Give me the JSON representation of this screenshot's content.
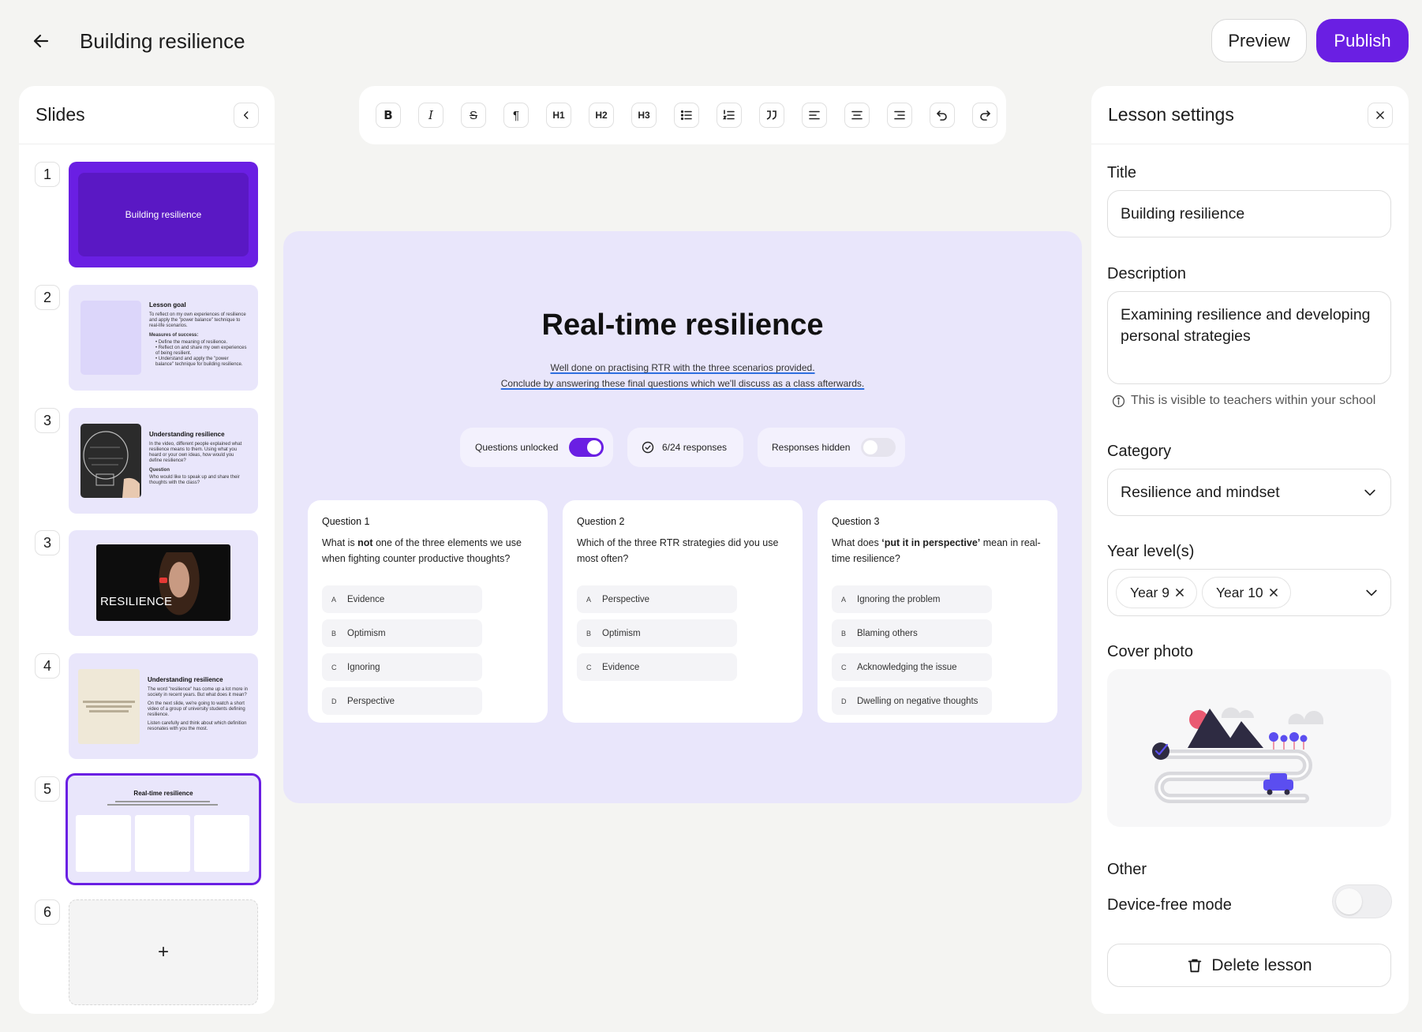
{
  "header": {
    "title": "Building resilience",
    "preview_label": "Preview",
    "publish_label": "Publish"
  },
  "colors": {
    "accent": "#6a1fe3",
    "canvas": "#e9e6fb",
    "background": "#f4f4f2"
  },
  "slides_panel": {
    "title": "Slides",
    "slides": [
      {
        "number": "1",
        "title": "Building resilience",
        "type": "title"
      },
      {
        "number": "2",
        "title": "Lesson goal",
        "body": "To reflect on my own experiences of resilience and apply the \"power balance\" technique to real-life scenarios.",
        "subhead": "Measures of success:",
        "bullets": [
          "Define the meaning of resilience.",
          "Reflect on and share my own experiences of being resilient.",
          "Understand and apply the \"power balance\" technique for building resilience."
        ]
      },
      {
        "number": "3",
        "title": "Understanding resilience",
        "body": "In the video, different people explained what resilience means to them. Using what you heard or your own ideas, how would you define resilience?",
        "subhead": "Question",
        "question": "Who would like to speak up and share their thoughts with the class?"
      },
      {
        "number": "3",
        "title": "RESILIENCE",
        "type": "video"
      },
      {
        "number": "4",
        "title": "Understanding resilience",
        "body1": "The word \"resilience\" has come up a lot more in society in recent years. But what does it mean?",
        "body2": "On the next slide, we're going to watch a short video of a group of university students defining resilience.",
        "body3": "Listen carefully and think about which definition resonates with you the most."
      },
      {
        "number": "5",
        "title": "Real-time resilience",
        "selected": true
      },
      {
        "number": "6",
        "add_label": "+"
      }
    ]
  },
  "toolbar": {
    "tools": [
      "bold",
      "italic",
      "strikethrough",
      "paragraph",
      "heading-1",
      "heading-2",
      "heading-3",
      "bullet-list",
      "numbered-list",
      "quote",
      "align-left",
      "align-center",
      "align-right",
      "undo",
      "redo"
    ],
    "labels": {
      "bold": "B",
      "italic": "I",
      "strike": "S",
      "para": "¶",
      "h1": "H1",
      "h2": "H2",
      "h3": "H3"
    }
  },
  "canvas": {
    "title": "Real-time resilience",
    "subtitle_line1": "Well done on practising RTR with the three scenarios provided.",
    "subtitle_line2": "Conclude by answering these final questions which we'll discuss as a class afterwards.",
    "questions_unlocked_label": "Questions unlocked",
    "questions_unlocked": true,
    "responses_label": "6/24 responses",
    "responses_hidden_label": "Responses hidden",
    "responses_hidden": false,
    "questions": [
      {
        "heading": "Question 1",
        "text_pre": "What is ",
        "text_bold": "not",
        "text_post": " one of the three elements we use when fighting counter productive thoughts?",
        "options": [
          {
            "letter": "A",
            "text": "Evidence"
          },
          {
            "letter": "B",
            "text": "Optimism"
          },
          {
            "letter": "C",
            "text": "Ignoring"
          },
          {
            "letter": "D",
            "text": "Perspective"
          }
        ]
      },
      {
        "heading": "Question 2",
        "text_pre": "Which of the three RTR strategies did you use most often?",
        "text_bold": "",
        "text_post": "",
        "options": [
          {
            "letter": "A",
            "text": "Perspective"
          },
          {
            "letter": "B",
            "text": "Optimism"
          },
          {
            "letter": "C",
            "text": "Evidence"
          }
        ]
      },
      {
        "heading": "Question 3",
        "text_pre": "What does ",
        "text_bold": "‘put it in perspective’",
        "text_post": " mean in real-time resilience?",
        "options": [
          {
            "letter": "A",
            "text": "Ignoring the problem"
          },
          {
            "letter": "B",
            "text": "Blaming others"
          },
          {
            "letter": "C",
            "text": "Acknowledging the issue"
          },
          {
            "letter": "D",
            "text": "Dwelling on negative thoughts"
          }
        ]
      }
    ]
  },
  "settings": {
    "title": "Lesson settings",
    "title_label": "Title",
    "title_value": "Building resilience",
    "description_label": "Description",
    "description_value": "Examining resilience and developing personal strategies",
    "visibility_note": "This is visible to teachers within your school",
    "category_label": "Category",
    "category_value": "Resilience and mindset",
    "year_levels_label": "Year level(s)",
    "year_levels": [
      "Year 9",
      "Year 10"
    ],
    "cover_photo_label": "Cover photo",
    "other_label": "Other",
    "device_free_label": "Device-free mode",
    "device_free": false,
    "delete_label": "Delete lesson"
  }
}
